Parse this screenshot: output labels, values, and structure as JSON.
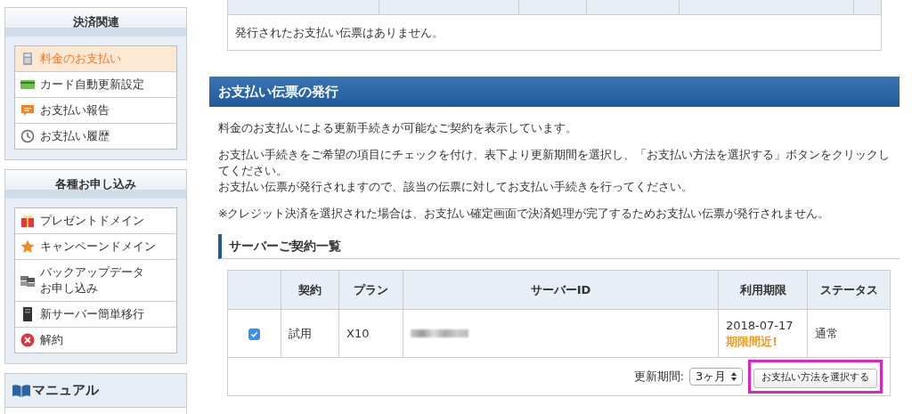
{
  "sidebar": {
    "sections": [
      {
        "title": "決済関連",
        "items": [
          {
            "label": "料金のお支払い",
            "selected": true
          },
          {
            "label": "カード自動更新設定",
            "selected": false
          },
          {
            "label": "お支払い報告",
            "selected": false
          },
          {
            "label": "お支払い履歴",
            "selected": false
          }
        ]
      },
      {
        "title": "各種お申し込み",
        "items": [
          {
            "label": "プレゼントドメイン",
            "selected": false
          },
          {
            "label": "キャンペーンドメイン",
            "selected": false
          },
          {
            "label": [
              "バックアップデータ",
              "お申し込み"
            ],
            "selected": false
          },
          {
            "label": "新サーバー簡単移行",
            "selected": false
          },
          {
            "label": "解約",
            "selected": false
          }
        ]
      }
    ],
    "manual": {
      "title": "マニュアル"
    }
  },
  "issued_slips": {
    "empty_message": "発行されたお支払い伝票はありません。"
  },
  "issue_section": {
    "title": "お支払い伝票の発行",
    "paragraphs": [
      [
        "料金のお支払いによる更新手続きが可能なご契約を表示しています。"
      ],
      [
        "お支払い手続きをご希望の項目にチェックを付け、表下より更新期間を選択し、「お支払い方法を選択する」ボタンをクリックしてください。",
        "お支払い伝票が発行されますので、該当の伝票に対してお支払い手続きを行ってください。"
      ],
      [
        "※クレジット決済を選択された場合は、お支払い確定画面で決済処理が完了するためお支払い伝票が発行されません。"
      ]
    ],
    "contracts": {
      "title": "サーバーご契約一覧",
      "columns": [
        "契約",
        "プラン",
        "サーバーID",
        "利用期限",
        "ステータス"
      ],
      "rows": [
        {
          "checked": true,
          "contract": "試用",
          "plan": "X10",
          "expiry": "2018-07-17",
          "warning": "期限間近!",
          "status": "通常"
        }
      ],
      "period_label": "更新期間:",
      "period_value": "3ヶ月",
      "submit": {
        "label": "お支払い方法を選択する",
        "highlighted": true
      }
    }
  }
}
